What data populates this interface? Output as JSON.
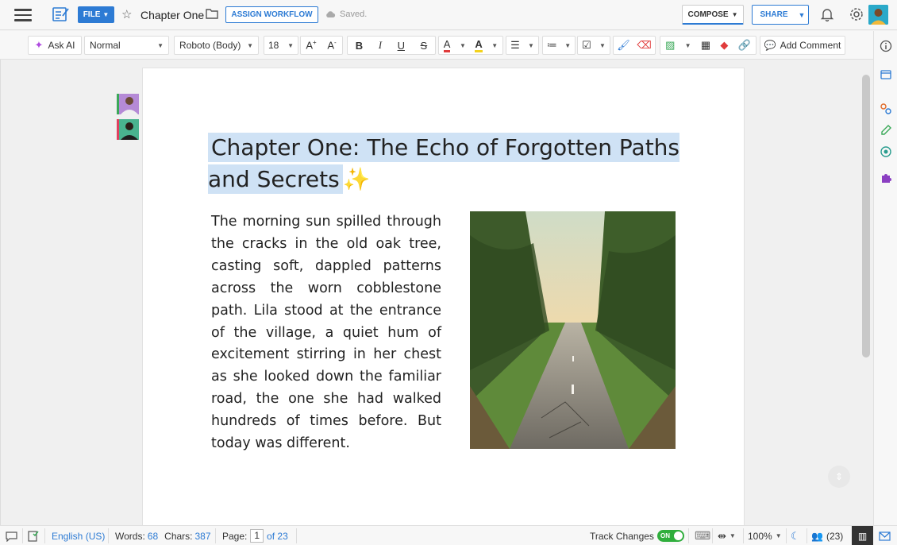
{
  "topbar": {
    "file_label": "FILE",
    "doc_title": "Chapter One",
    "assign_workflow": "ASSIGN WORKFLOW",
    "saved_status": "Saved.",
    "compose_label": "COMPOSE",
    "share_label": "SHARE"
  },
  "toolbar": {
    "ask_ai": "Ask AI",
    "style": "Normal",
    "font": "Roboto (Body)",
    "size": "18",
    "add_comment": "Add Comment"
  },
  "document": {
    "title": "Chapter One: The Echo of Forgotten Paths and Secrets",
    "title_sparkle": "✨",
    "body": "The morning sun spilled through the cracks in the old oak tree, casting soft, dappled patterns across the worn cobblestone path. Lila stood at the entrance of the village, a quiet hum of excitement stirring in her chest as she looked down the familiar road, the one she had walked hundreds of times before. But today was different."
  },
  "statusbar": {
    "language": "English (US)",
    "words_label": "Words:",
    "words_value": "68",
    "chars_label": "Chars:",
    "chars_value": "387",
    "page_label": "Page:",
    "page_current": "1",
    "page_of": "of 23",
    "track_changes": "Track Changes",
    "toggle_state": "ON",
    "zoom": "100%",
    "collaborators": "(23)"
  },
  "colors": {
    "accent": "#2d7bd4",
    "title_highlight": "#cfe2f5",
    "toggle_on": "#2fae3c"
  }
}
